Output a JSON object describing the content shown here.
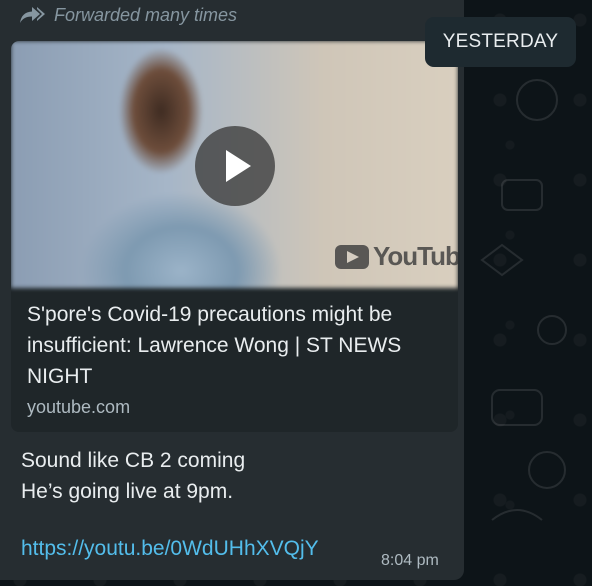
{
  "message": {
    "forwarded_label": "Forwarded many times",
    "preview": {
      "title": "S'pore's Covid-19 precautions might be insufficient: Lawrence Wong | ST NEWS NIGHT",
      "domain": "youtube.com",
      "logo_text": "YouTube"
    },
    "text_line_1": "Sound like CB 2 coming",
    "text_line_2": "He’s going live at 9pm.",
    "link": "https://youtu.be/0WdUHhXVQjY",
    "time": "8:04 pm"
  },
  "date_divider": "YESTERDAY",
  "colors": {
    "bubble": "#262d31",
    "link": "#53bdeb",
    "text": "#e9edef",
    "meta": "#8696a0"
  },
  "icons": {
    "forwarded": "forward-arrows-icon",
    "play": "play-icon",
    "youtube": "youtube-logo-icon"
  }
}
